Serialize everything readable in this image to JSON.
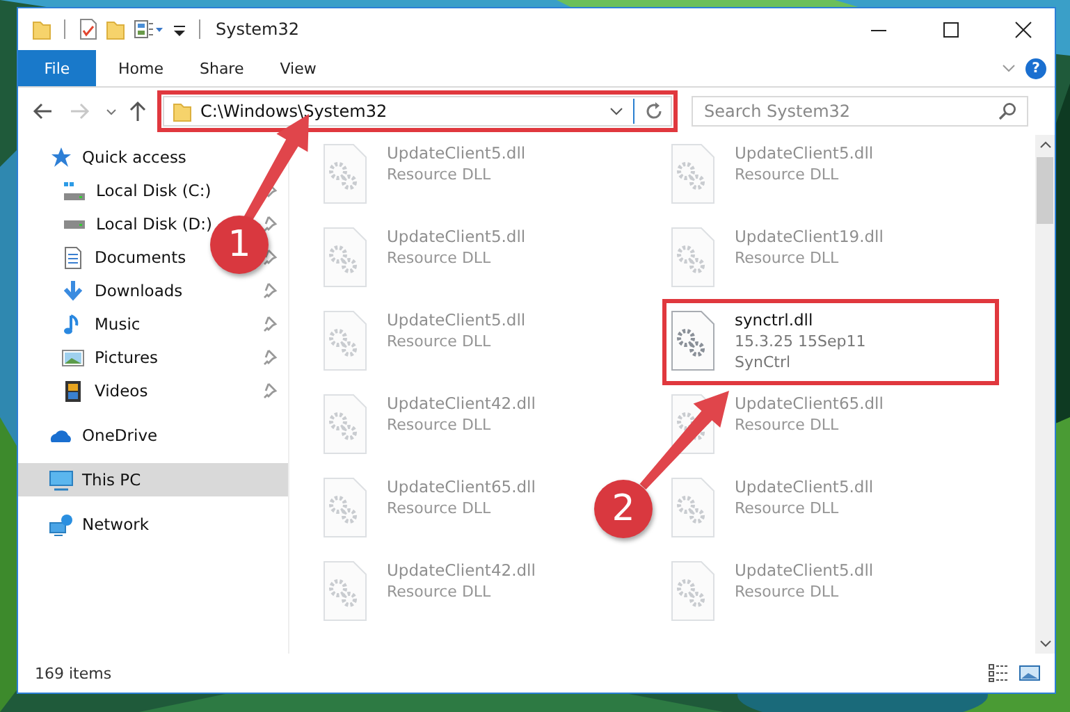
{
  "window": {
    "title": "System32"
  },
  "ribbon": {
    "tabs": [
      {
        "label": "File",
        "kind": "file"
      },
      {
        "label": "Home",
        "kind": "tab"
      },
      {
        "label": "Share",
        "kind": "tab"
      },
      {
        "label": "View",
        "kind": "tab"
      }
    ],
    "help": "?"
  },
  "address_bar": {
    "path": "C:\\Windows\\System32",
    "highlighted": true,
    "forward_disabled": true
  },
  "search": {
    "placeholder": "Search System32"
  },
  "sidebar": {
    "items": [
      {
        "label": "Quick access",
        "kind": "quick-access",
        "selected": false,
        "children": [
          {
            "label": "Local Disk (C:)",
            "kind": "system-drive",
            "pinned": true,
            "selected": false
          },
          {
            "label": "Local Disk (D:)",
            "kind": "drive",
            "pinned": true,
            "selected": false
          },
          {
            "label": "Documents",
            "kind": "documents",
            "pinned": true,
            "selected": false
          },
          {
            "label": "Downloads",
            "kind": "downloads",
            "pinned": true,
            "selected": false
          },
          {
            "label": "Music",
            "kind": "music",
            "pinned": true,
            "selected": false
          },
          {
            "label": "Pictures",
            "kind": "pictures",
            "pinned": true,
            "selected": false
          },
          {
            "label": "Videos",
            "kind": "videos",
            "pinned": true,
            "selected": false
          }
        ]
      },
      {
        "label": "OneDrive",
        "kind": "cloud",
        "selected": false
      },
      {
        "label": "This PC",
        "kind": "computer",
        "selected": true
      },
      {
        "label": "Network",
        "kind": "network",
        "selected": false
      }
    ]
  },
  "files": [
    {
      "name": "UpdateClient5.dll",
      "lines": [
        "Resource DLL"
      ],
      "dimmed": true,
      "highlighted": false
    },
    {
      "name": "UpdateClient5.dll",
      "lines": [
        "Resource DLL"
      ],
      "dimmed": true,
      "highlighted": false
    },
    {
      "name": "UpdateClient5.dll",
      "lines": [
        "Resource DLL"
      ],
      "dimmed": true,
      "highlighted": false
    },
    {
      "name": "UpdateClient19.dll",
      "lines": [
        "Resource DLL"
      ],
      "dimmed": true,
      "highlighted": false
    },
    {
      "name": "UpdateClient5.dll",
      "lines": [
        "Resource DLL"
      ],
      "dimmed": true,
      "highlighted": false
    },
    {
      "name": "synctrl.dll",
      "lines": [
        "15.3.25 15Sep11",
        "SynCtrl"
      ],
      "dimmed": false,
      "highlighted": true
    },
    {
      "name": "UpdateClient42.dll",
      "lines": [
        "Resource DLL"
      ],
      "dimmed": true,
      "highlighted": false
    },
    {
      "name": "UpdateClient65.dll",
      "lines": [
        "Resource DLL"
      ],
      "dimmed": true,
      "highlighted": false
    },
    {
      "name": "UpdateClient65.dll",
      "lines": [
        "Resource DLL"
      ],
      "dimmed": true,
      "highlighted": false
    },
    {
      "name": "UpdateClient5.dll",
      "lines": [
        "Resource DLL"
      ],
      "dimmed": true,
      "highlighted": false
    },
    {
      "name": "UpdateClient42.dll",
      "lines": [
        "Resource DLL"
      ],
      "dimmed": true,
      "highlighted": false
    },
    {
      "name": "UpdateClient5.dll",
      "lines": [
        "Resource DLL"
      ],
      "dimmed": true,
      "highlighted": false
    }
  ],
  "status_bar": {
    "count": "169 items"
  },
  "annotations": [
    {
      "number": "1"
    },
    {
      "number": "2"
    }
  ]
}
